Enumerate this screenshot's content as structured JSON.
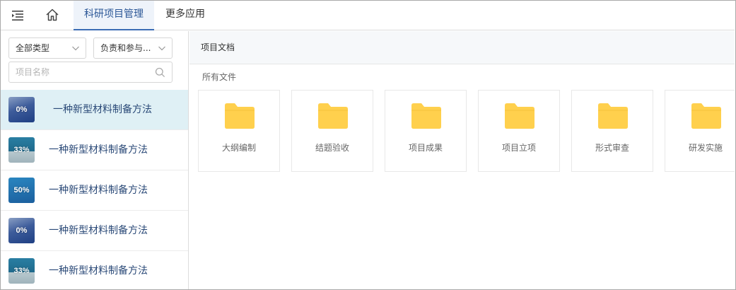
{
  "topbar": {
    "menu_icon": "menu-fold-icon",
    "home_icon": "home-icon",
    "tabs": [
      {
        "label": "科研项目管理",
        "active": true
      },
      {
        "label": "更多应用",
        "active": false
      }
    ]
  },
  "filters": {
    "type_select": "全部类型",
    "role_select": "负责和参与...",
    "search_placeholder": "项目名称"
  },
  "projects": [
    {
      "percent": "0%",
      "name": "一种新型材料制备方法",
      "active": true
    },
    {
      "percent": "33%",
      "name": "一种新型材料制备方法",
      "active": false
    },
    {
      "percent": "50%",
      "name": "一种新型材料制备方法",
      "active": false
    },
    {
      "percent": "0%",
      "name": "一种新型材料制备方法",
      "active": false
    },
    {
      "percent": "33%",
      "name": "一种新型材料制备方法",
      "active": false
    }
  ],
  "documents": {
    "title": "项目文档",
    "breadcrumb": "所有文件",
    "folder_color": "#ffd04d",
    "folders": [
      "大纲编制",
      "结题验收",
      "项目成果",
      "项目立项",
      "形式审查",
      "研发实施"
    ]
  },
  "colors": {
    "accent": "#3b6cb4",
    "active_item_bg": "#dff0f5"
  }
}
